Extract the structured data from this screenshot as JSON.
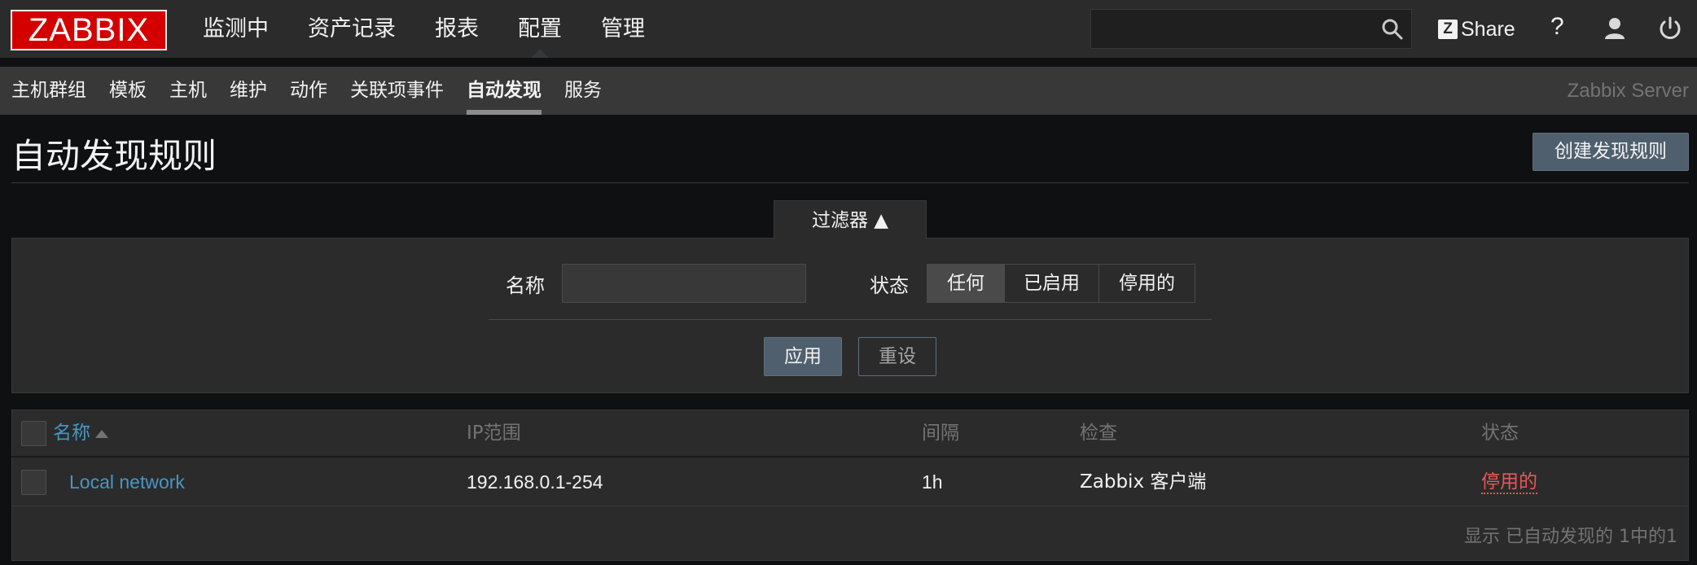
{
  "topbar": {
    "logo": "ZABBIX",
    "menu": [
      {
        "label": "监测中"
      },
      {
        "label": "资产记录"
      },
      {
        "label": "报表"
      },
      {
        "label": "配置"
      },
      {
        "label": "管理"
      }
    ],
    "active_menu": "配置",
    "search_value": "",
    "share_label": "Share",
    "help_label": "?"
  },
  "subbar": {
    "items": [
      {
        "label": "主机群组"
      },
      {
        "label": "模板"
      },
      {
        "label": "主机"
      },
      {
        "label": "维护"
      },
      {
        "label": "动作"
      },
      {
        "label": "关联项事件"
      },
      {
        "label": "自动发现"
      },
      {
        "label": "服务"
      }
    ],
    "active_item": "自动发现",
    "server_name": "Zabbix Server"
  },
  "page": {
    "title": "自动发现规则",
    "create_button": "创建发现规则"
  },
  "filter": {
    "tab_label": "过滤器 ▲",
    "name_label": "名称",
    "name_value": "",
    "status_label": "状态",
    "status_options": [
      "任何",
      "已启用",
      "停用的"
    ],
    "status_selected": "任何",
    "apply_label": "应用",
    "reset_label": "重设"
  },
  "table": {
    "headers": {
      "name": "名称",
      "ip_range": "IP范围",
      "interval": "间隔",
      "checks": "检查",
      "status": "状态"
    },
    "rows": [
      {
        "name": "Local network",
        "ip_range": "192.168.0.1-254",
        "interval": "1h",
        "checks": "Zabbix 客户端",
        "status": "停用的"
      }
    ],
    "footer": "显示 已自动发现的 1中的1"
  },
  "colors": {
    "logo_red": "#d40000",
    "link_blue": "#4796c4",
    "disabled_red": "#e45959",
    "button_blue_gray": "#4f5f6e"
  }
}
